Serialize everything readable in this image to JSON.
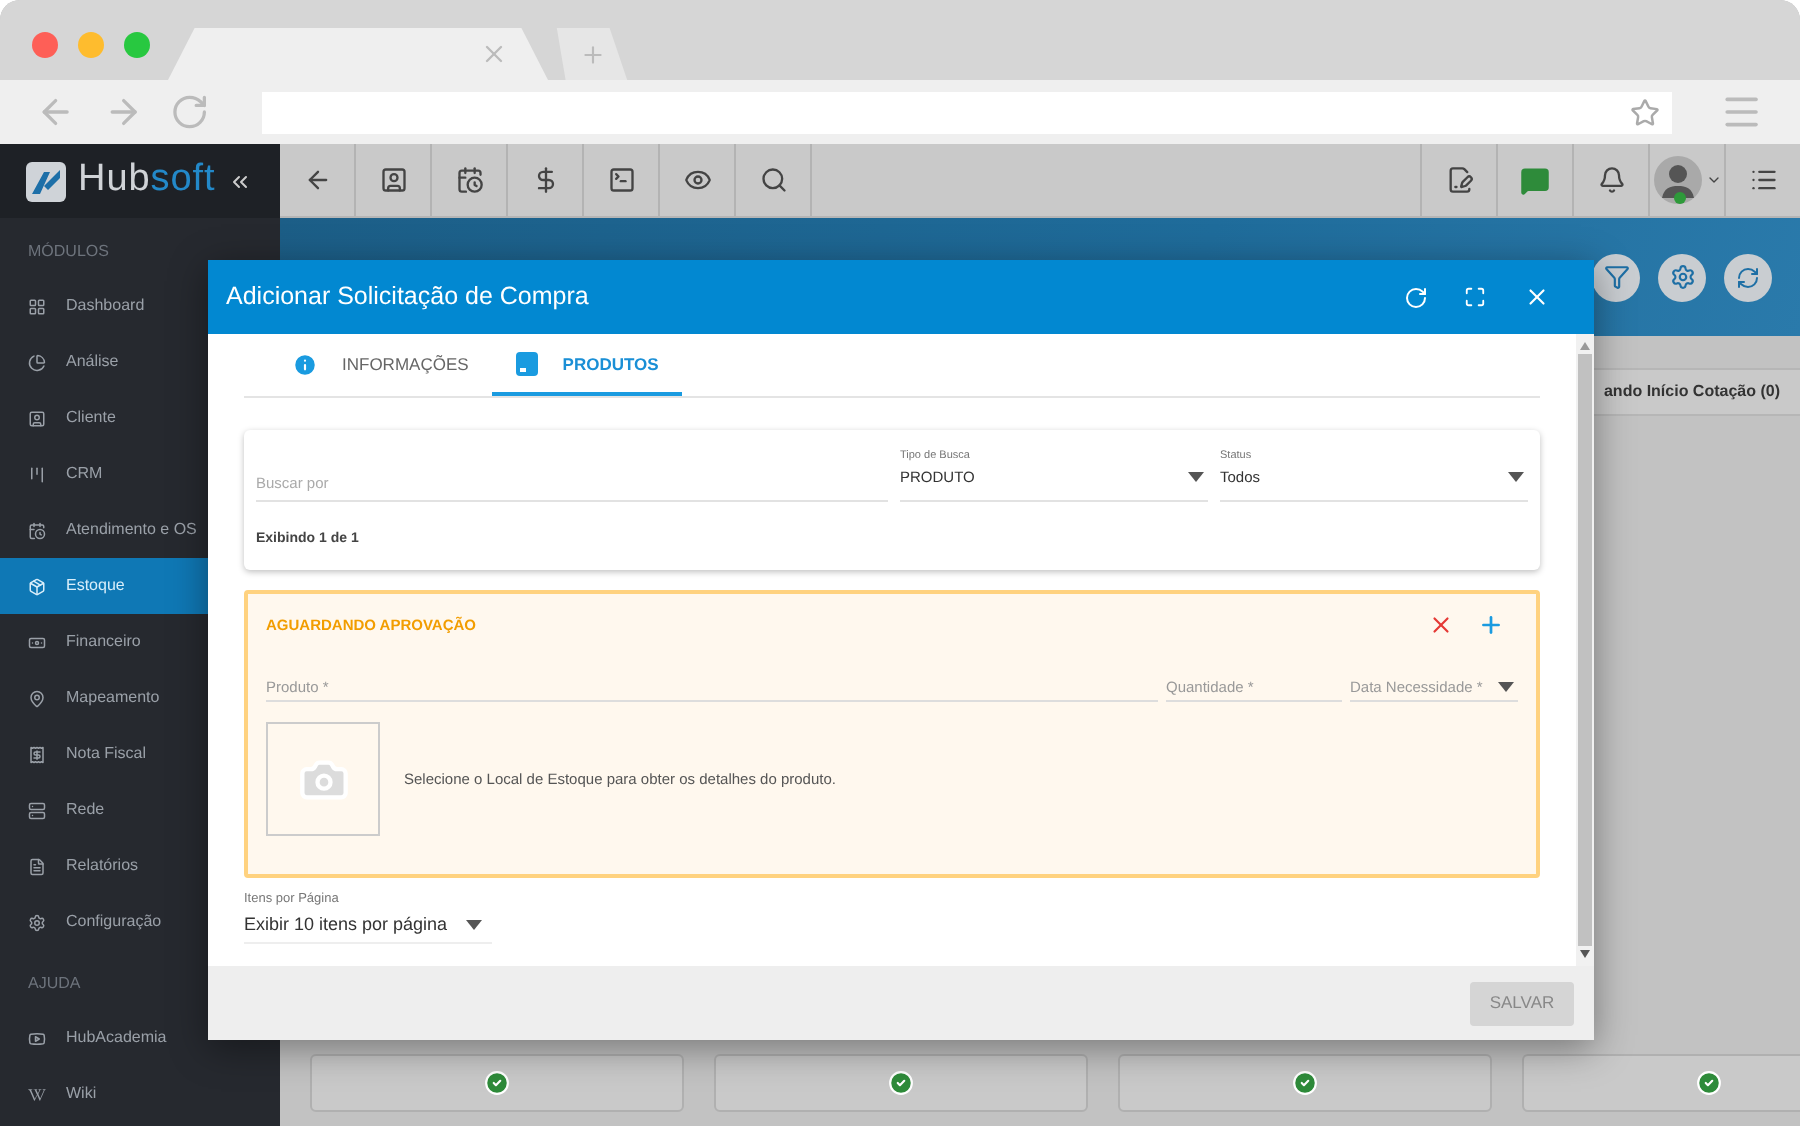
{
  "sidebar": {
    "logo_main": "Hub",
    "logo_accent": "soft",
    "sections": [
      {
        "title": "MÓDULOS",
        "items": [
          {
            "label": "Dashboard",
            "selected": false
          },
          {
            "label": "Análise",
            "selected": false
          },
          {
            "label": "Cliente",
            "selected": false
          },
          {
            "label": "CRM",
            "selected": false
          },
          {
            "label": "Atendimento e OS",
            "selected": false
          },
          {
            "label": "Estoque",
            "selected": true
          },
          {
            "label": "Financeiro",
            "selected": false
          },
          {
            "label": "Mapeamento",
            "selected": false
          },
          {
            "label": "Nota Fiscal",
            "selected": false
          },
          {
            "label": "Rede",
            "selected": false
          },
          {
            "label": "Relatórios",
            "selected": false
          },
          {
            "label": "Configuração",
            "selected": false
          }
        ]
      },
      {
        "title": "AJUDA",
        "items": [
          {
            "label": "HubAcademia",
            "selected": false
          },
          {
            "label": "Wiki",
            "selected": false
          }
        ]
      }
    ]
  },
  "background": {
    "tab_label": "ando Início Cotação (0)",
    "cards": [
      {
        "checked": true
      },
      {
        "checked": true
      },
      {
        "checked": true
      },
      {
        "checked": true
      }
    ]
  },
  "modal": {
    "title": "Adicionar Solicitação de Compra",
    "tabs": [
      {
        "label": "INFORMAÇÕES",
        "selected": false
      },
      {
        "label": "PRODUTOS",
        "selected": true
      }
    ],
    "filter": {
      "search_placeholder": "Buscar por",
      "type_label": "Tipo de Busca",
      "type_value": "PRODUTO",
      "status_label": "Status",
      "status_value": "Todos",
      "count": "Exibindo 1 de 1"
    },
    "item": {
      "status": "AGUARDANDO APROVAÇÃO",
      "product_placeholder": "Produto *",
      "quantity_placeholder": "Quantidade *",
      "date_placeholder": "Data Necessidade *",
      "message": "Selecione o Local de Estoque para obter os detalhes do produto."
    },
    "per_page": {
      "label": "Itens por Página",
      "value": "Exibir 10 itens por página"
    },
    "save": {
      "label": "SALVAR",
      "disabled": true
    }
  }
}
